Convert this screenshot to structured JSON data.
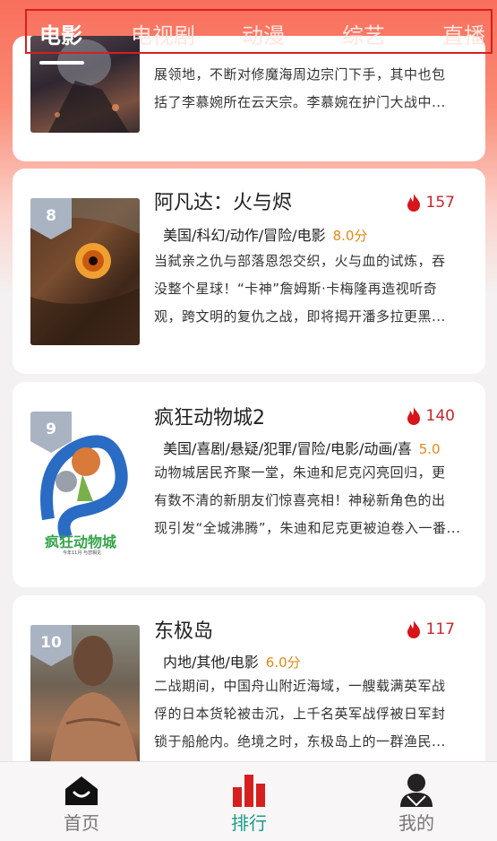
{
  "top_tabs": [
    "电影",
    "电视剧",
    "动漫",
    "综艺",
    "直播"
  ],
  "active_tab": "电影",
  "partial_card": {
    "desc_line1": "展领地，不断对修魔海周边宗门下手，其中也包",
    "desc_line2": "括了李慕婉所在云天宗。李慕婉在护门大战中..."
  },
  "items": [
    {
      "rank": "8",
      "title": "阿凡达：火与烬",
      "hot": "157",
      "meta": "美国/科幻/动作/冒险/电影",
      "score": "8.0分",
      "desc": [
        "当弑亲之仇与部落恩怨交织，火与血的试炼，吞",
        "没整个星球！“卡神”詹姆斯·卡梅隆再造视听奇",
        "观，跨文明的复仇之战，即将揭开潘多拉更黑..."
      ]
    },
    {
      "rank": "9",
      "title": "疯狂动物城2",
      "hot": "140",
      "meta": "美国/喜剧/悬疑/犯罪/冒险/电影/动画/喜",
      "score": "5.0",
      "poster_text": "疯狂动物城",
      "poster_sub": "今年11月 与您相见",
      "desc": [
        "动物城居民齐聚一堂，朱迪和尼克闪亮回归，更",
        "有数不清的新朋友们惊喜亮相！神秘新角色的出",
        "现引发“全城沸腾”，朱迪和尼克更被迫卷入一番..."
      ]
    },
    {
      "rank": "10",
      "title": "东极岛",
      "hot": "117",
      "meta": "内地/其他/电影",
      "score": "6.0分",
      "desc": [
        "二战期间，中国舟山附近海域，一艘载满英军战",
        "俘的日本货轮被击沉，上千名英军战俘被日军封",
        "锁于船舱内。绝境之时，东极岛上的一群渔民..."
      ]
    }
  ],
  "bottom_nav": [
    "首页",
    "排行",
    "我的"
  ],
  "active_nav": "排行",
  "colors": {
    "accent": "#1a9c8c",
    "hot": "#c9262c",
    "score": "#e08a16",
    "rank_badge": "#a9b3c2"
  }
}
